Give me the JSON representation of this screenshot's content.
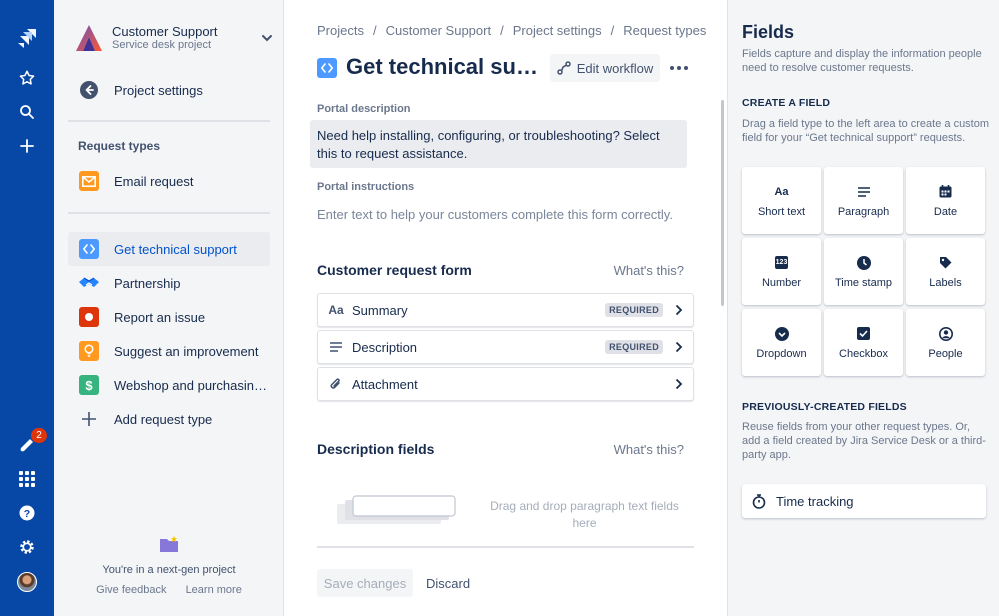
{
  "global_nav": {
    "notification_count": "2",
    "icons": [
      "jira-logo-icon",
      "star-icon",
      "search-icon",
      "plus-icon",
      "notifications-icon",
      "app-switcher-icon",
      "help-icon",
      "settings-icon",
      "avatar"
    ]
  },
  "sidebar": {
    "project_name": "Customer Support",
    "project_type": "Service desk project",
    "back_label": "Project settings",
    "section_title": "Request types",
    "request_types": [
      {
        "label": "Email request",
        "icon": "email-icon",
        "color": "#ff991f"
      },
      {
        "label": "Get technical support",
        "icon": "code-icon",
        "color": "#4c9aff"
      },
      {
        "label": "Partnership",
        "icon": "handshake-icon",
        "color": "#2684ff"
      },
      {
        "label": "Report an issue",
        "icon": "record-icon",
        "color": "#de350b"
      },
      {
        "label": "Suggest an improvement",
        "icon": "lightbulb-icon",
        "color": "#ff991f"
      },
      {
        "label": "Webshop and purchasin…",
        "icon": "dollar-icon",
        "color": "#36b37e"
      }
    ],
    "add_label": "Add request type",
    "footer_text": "You're in a next-gen project",
    "give_feedback": "Give feedback",
    "learn_more": "Learn more"
  },
  "main": {
    "breadcrumbs": [
      "Projects",
      "Customer Support",
      "Project settings",
      "Request types"
    ],
    "title": "Get technical su…",
    "edit_workflow": "Edit workflow",
    "portal_description_label": "Portal description",
    "portal_description": "Need help installing, configuring, or troubleshooting? Select this to request assistance.",
    "portal_instructions_label": "Portal instructions",
    "portal_instructions_placeholder": "Enter text to help your customers complete this form correctly.",
    "form_title": "Customer request form",
    "whats_this": "What's this?",
    "form_fields": [
      {
        "icon": "Aa",
        "label": "Summary",
        "badge": "REQUIRED"
      },
      {
        "icon": "paragraph-icon",
        "label": "Description",
        "badge": "REQUIRED"
      },
      {
        "icon": "attachment-icon",
        "label": "Attachment",
        "badge": ""
      }
    ],
    "desc_fields_title": "Description fields",
    "desc_whats_this": "What's this?",
    "drop_text": "Drag and drop paragraph text fields here",
    "save_changes": "Save changes",
    "discard": "Discard"
  },
  "panel": {
    "title": "Fields",
    "intro": "Fields capture and display the information people need to resolve customer requests.",
    "create_heading": "CREATE A FIELD",
    "create_desc": "Drag a field type to the left area to create a custom field for your “Get technical support” requests.",
    "tiles": [
      {
        "label": "Short text",
        "icon": "Aa"
      },
      {
        "label": "Paragraph",
        "icon": "paragraph-icon"
      },
      {
        "label": "Date",
        "icon": "calendar-icon"
      },
      {
        "label": "Number",
        "icon": "123"
      },
      {
        "label": "Time stamp",
        "icon": "clock-icon"
      },
      {
        "label": "Labels",
        "icon": "label-icon"
      },
      {
        "label": "Dropdown",
        "icon": "dropdown-icon"
      },
      {
        "label": "Checkbox",
        "icon": "checkbox-icon"
      },
      {
        "label": "People",
        "icon": "person-icon"
      }
    ],
    "prev_heading": "PREVIOUSLY-CREATED FIELDS",
    "prev_desc": "Reuse fields from your other request types. Or, add a field created by Jira Service Desk or a third-party app.",
    "prev_fields": [
      {
        "label": "Time tracking",
        "icon": "stopwatch-icon"
      }
    ]
  }
}
